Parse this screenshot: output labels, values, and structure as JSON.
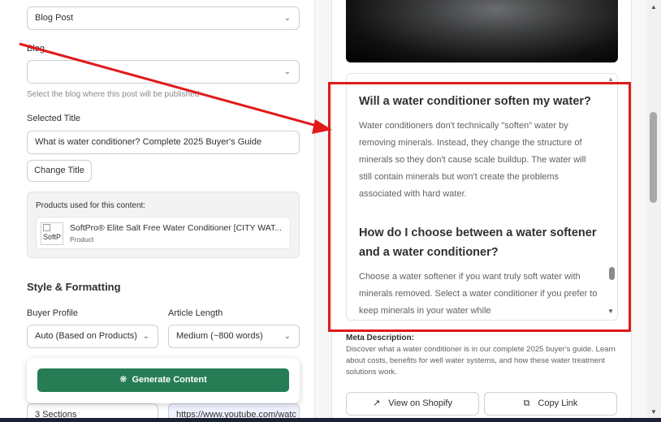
{
  "form": {
    "content_type": "Blog Post",
    "blog_label": "Blog",
    "blog_value": "",
    "blog_help": "Select the blog where this post will be published",
    "selected_title_label": "Selected Title",
    "selected_title_value": "What is water conditioner? Complete 2025 Buyer's Guide",
    "change_title_button": "Change Title",
    "products_label": "Products used for this content:",
    "product": {
      "thumb_alt": "SoftP",
      "name": "SoftPro® Elite Salt Free Water Conditioner [CITY WAT...",
      "type": "Product"
    },
    "style_section_title": "Style & Formatting",
    "buyer_profile_label": "Buyer Profile",
    "buyer_profile_value": "Auto (Based on Products)",
    "article_length_label": "Article Length",
    "article_length_value": "Medium (~800 words)",
    "sections_value": "3 Sections",
    "video_url_value": "https://www.youtube.com/watc",
    "generate_button": "Generate Content",
    "accent_color": "#267d55"
  },
  "preview": {
    "faq": [
      {
        "question": "Will a water conditioner soften my water?",
        "answer": "Water conditioners don't technically \"soften\" water by removing minerals. Instead, they change the structure of minerals so they don't cause scale buildup. The water will still contain minerals but won't create the problems associated with hard water."
      },
      {
        "question": "How do I choose between a water softener and a water conditioner?",
        "answer": "Choose a water softener if you want truly soft water with minerals removed. Select a water conditioner if you prefer to keep minerals in your water while"
      }
    ],
    "meta_label": "Meta Description:",
    "meta_text": "Discover what a water conditioner is in our complete 2025 buyer's guide. Learn about costs, benefits for well water systems, and how these water treatment solutions work.",
    "view_on_shopify": "View on Shopify",
    "copy_link": "Copy Link"
  },
  "annotation": {
    "color": "#e11a1a"
  }
}
